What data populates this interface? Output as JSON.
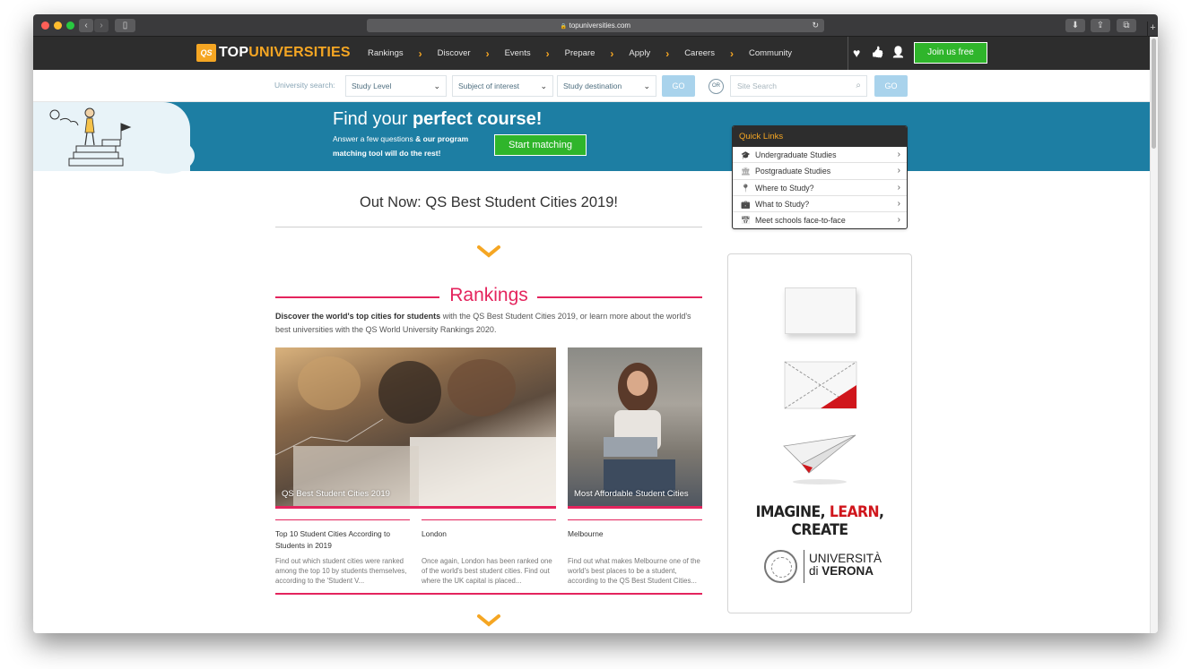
{
  "browser": {
    "url": "topuniversities.com",
    "lock_icon": "🔒",
    "reload_icon": "↻",
    "back_icon": "‹",
    "forward_icon": "›",
    "sidebar_icon": "▯",
    "download_icon": "⬇",
    "share_icon": "⇪",
    "tabs_icon": "⧉",
    "newtab_icon": "+"
  },
  "site": {
    "logo_qs": "QS",
    "logo_top": "TOP",
    "logo_universities": "UNIVERSITIES",
    "nav": [
      "Rankings",
      "Discover",
      "Events",
      "Prepare",
      "Apply",
      "Careers",
      "Community"
    ],
    "nav_chevron": "›",
    "heart_icon": "♥",
    "thumb_icon": "👍",
    "user_icon": "👤",
    "join_label": "Join us free"
  },
  "search": {
    "label": "University search:",
    "study_level": "Study Level",
    "subject": "Subject of interest",
    "destination": "Study destination",
    "go_label": "GO",
    "or_label": "OR",
    "site_search_placeholder": "Site Search",
    "caret": "⌄",
    "mag_icon": "⌕"
  },
  "banner": {
    "heading_prefix": "Find your ",
    "heading_bold": "perfect course!",
    "sub_prefix": "Answer a few questions ",
    "sub_bold": "& our program matching tool will do the rest!",
    "start_label": "Start matching"
  },
  "quick_links": {
    "title": "Quick Links",
    "items": [
      {
        "label": "Undergraduate Studies",
        "icon": "🎓"
      },
      {
        "label": "Postgraduate Studies",
        "icon": "🏛"
      },
      {
        "label": "Where to Study?",
        "icon": "📍"
      },
      {
        "label": "What to Study?",
        "icon": "💼"
      },
      {
        "label": "Meet schools face-to-face",
        "icon": "📅"
      }
    ],
    "chevron": "›"
  },
  "main": {
    "out_now": "Out Now: QS Best Student Cities 2019!",
    "rankings_title": "Rankings",
    "rankings_desc_bold": "Discover the world's top cities for students",
    "rankings_desc_rest": " with the QS Best Student Cities 2019, or learn more about the world's best universities with the QS World University Rankings 2020.",
    "card1_caption": "QS Best Student Cities 2019",
    "card2_caption": "Most Affordable Student Cities",
    "articles": [
      {
        "title": "Top 10 Student Cities According to Students in 2019",
        "desc": "Find out which student cities were ranked among the top 10 by students themselves, according to the 'Student V..."
      },
      {
        "title": "London",
        "desc": "Once again, London has been ranked one of the world's best student cities. Find out where the UK capital is placed..."
      },
      {
        "title": "Melbourne",
        "desc": "Find out what makes Melbourne one of the world's best places to be a student, according to the QS Best Student Cities..."
      }
    ]
  },
  "ad": {
    "slogan_1": "IMAGINE, ",
    "slogan_2": "LEARN",
    "slogan_3": ", CREATE",
    "univ_line1": "UNIVERSITÀ",
    "univ_di": "di ",
    "univ_verona": "VERONA"
  },
  "colors": {
    "accent_pink": "#e4245d",
    "accent_orange": "#f5a623",
    "green": "#2fb52b",
    "banner_blue": "#1d7ea3",
    "nav_dark": "#2d2d2d"
  }
}
